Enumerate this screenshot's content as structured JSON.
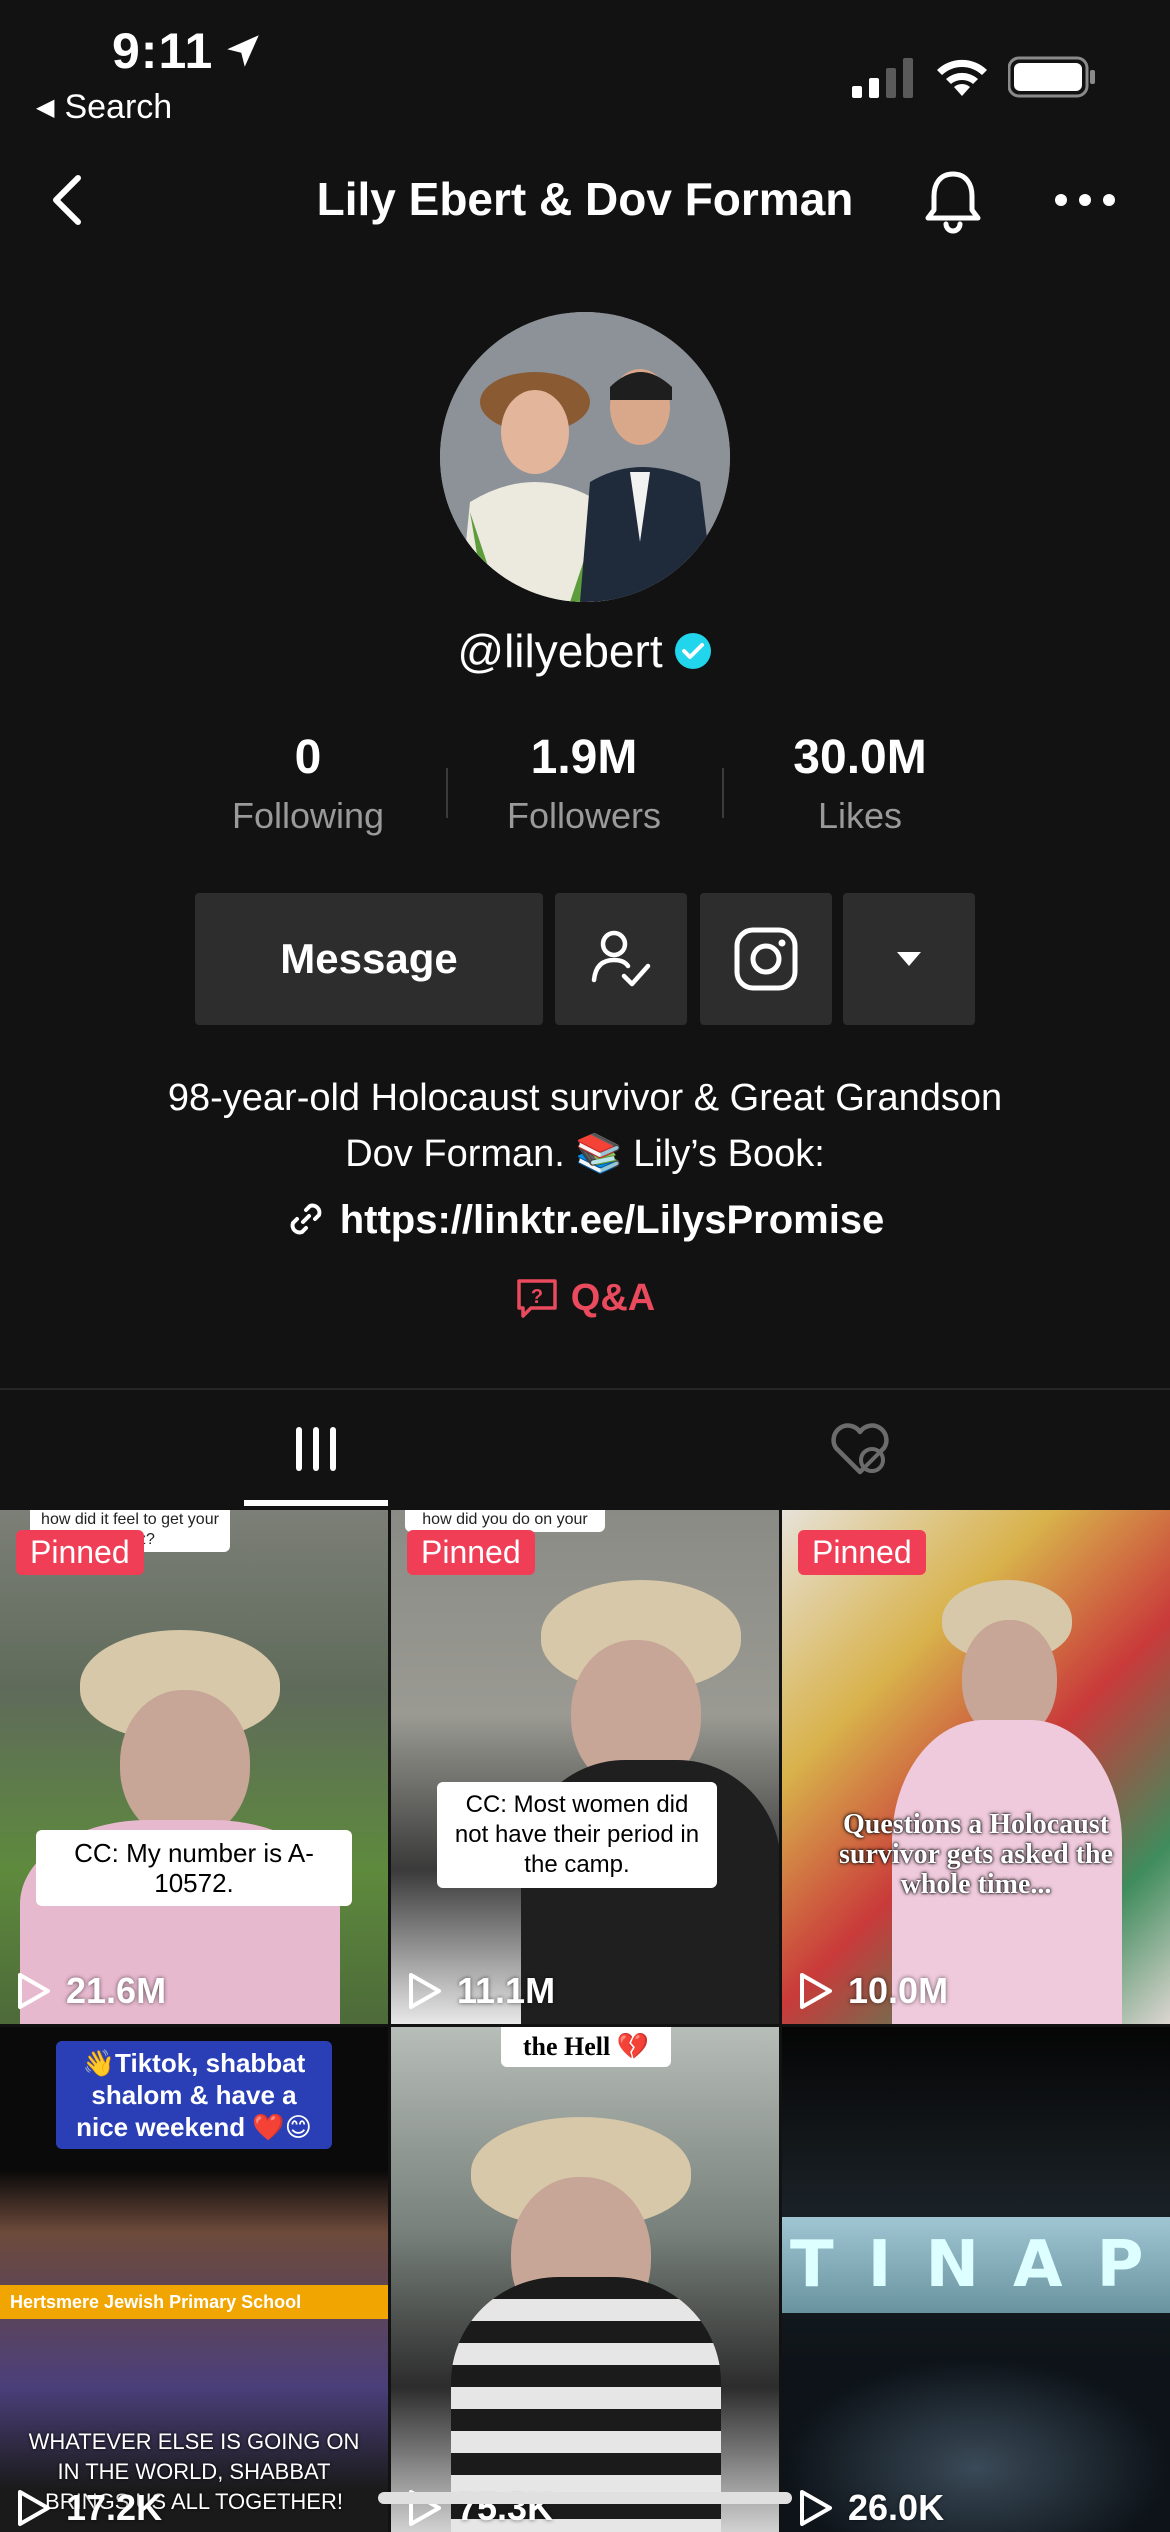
{
  "status_bar": {
    "time": "9:11",
    "back_app": "Search"
  },
  "nav": {
    "title": "Lily Ebert & Dov Forman"
  },
  "profile": {
    "username": "@lilyebert",
    "verified": true,
    "stats": [
      {
        "value": "0",
        "label": "Following"
      },
      {
        "value": "1.9M",
        "label": "Followers"
      },
      {
        "value": "30.0M",
        "label": "Likes"
      }
    ],
    "message_label": "Message",
    "bio_line1": "98-year-old Holocaust survivor & Great Grandson",
    "bio_line2": "Dov Forman. 📚 Lily’s Book:",
    "link": "https://linktr.ee/LilysPromise",
    "qa_label": "Q&A"
  },
  "tabs": [
    {
      "icon": "grid-icon",
      "active": true
    },
    {
      "icon": "liked-hidden-icon",
      "active": false
    }
  ],
  "videos": [
    {
      "pinned": "Pinned",
      "top_snip": "how did it feel to get your ...witz?",
      "caption": "CC: My number is A-10572.",
      "views": "21.6M"
    },
    {
      "pinned": "Pinned",
      "top_snip": "how did you do on your",
      "caption": "CC: Most women did not have their period in the camp.",
      "views": "11.1M"
    },
    {
      "pinned": "Pinned",
      "caption": "Questions a Holocaust survivor gets asked the whole time...",
      "views": "10.0M"
    },
    {
      "banner": "👋Tiktok, shabbat shalom & have a nice weekend ❤️😊",
      "school": "Hertsmere Jewish Primary School",
      "caption": "WHATEVER ELSE IS GOING ON IN THE WORLD, SHABBAT BRINGS US ALL TOGETHER!",
      "views": "17.2K"
    },
    {
      "banner": "the Hell 💔",
      "views": "75.3K"
    },
    {
      "overlay": "TINAP",
      "views": "26.0K"
    }
  ],
  "colors": {
    "background": "#121212",
    "accent_red": "#f03e56",
    "qa_red": "#e94a5d",
    "verified_blue": "#20d5ec",
    "button_bg": "#2d2d2d"
  }
}
